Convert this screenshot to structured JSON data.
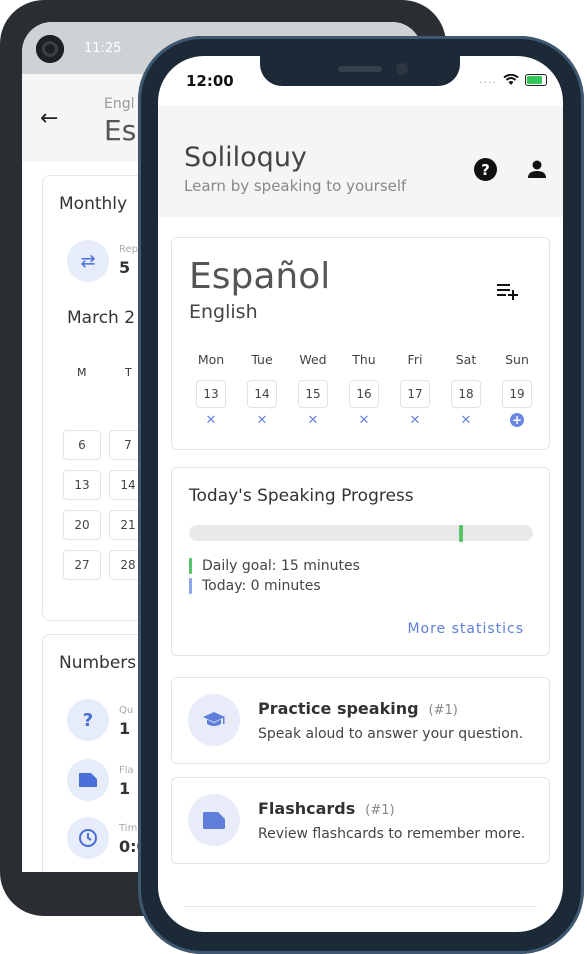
{
  "back_phone": {
    "status_time": "11:25",
    "header_subtitle": "Engl",
    "header_title": "Es",
    "card1_title": "Monthly",
    "repeat_label": "Rep",
    "repeat_value": "5",
    "month_label": "March 2",
    "dow": [
      "M",
      "T"
    ],
    "days": [
      "6",
      "7",
      "13",
      "14",
      "20",
      "21",
      "27",
      "28"
    ],
    "card2_title": "Numbers",
    "stats": [
      {
        "icon": "question-icon",
        "label": "Qu",
        "value": "1"
      },
      {
        "icon": "flashcard-icon",
        "label": "Fla",
        "value": "1"
      },
      {
        "icon": "clock-icon",
        "label": "Tim",
        "value": "0:0"
      }
    ]
  },
  "status_bar": {
    "time": "12:00",
    "signal": "....",
    "wifi": "wifi-icon",
    "battery": "battery-charging-icon"
  },
  "header": {
    "title": "Soliloquy",
    "subtitle": "Learn by speaking to yourself",
    "help_icon": "help-icon",
    "profile_icon": "person-icon"
  },
  "language_card": {
    "language": "Español",
    "native": "English",
    "add_icon": "playlist-add-icon",
    "week": [
      {
        "day": "Mon",
        "date": "13",
        "status": "missed"
      },
      {
        "day": "Tue",
        "date": "14",
        "status": "missed"
      },
      {
        "day": "Wed",
        "date": "15",
        "status": "missed"
      },
      {
        "day": "Thu",
        "date": "16",
        "status": "missed"
      },
      {
        "day": "Fri",
        "date": "17",
        "status": "missed"
      },
      {
        "day": "Sat",
        "date": "18",
        "status": "missed"
      },
      {
        "day": "Sun",
        "date": "19",
        "status": "today"
      }
    ],
    "missed_mark": "✕",
    "today_mark": "+"
  },
  "progress_card": {
    "title": "Today's Speaking Progress",
    "goal_fraction": 0.79,
    "today_fraction": 0,
    "goal_text": "Daily goal: 15 minutes",
    "today_text": "Today: 0 minutes",
    "goal_color": "#57c46a",
    "today_color": "#8fa6ea",
    "more_stats": "More statistics"
  },
  "activities": [
    {
      "title": "Practice speaking",
      "count": "(#1)",
      "desc": "Speak aloud to answer your question.",
      "icon": "graduation-cap-icon"
    },
    {
      "title": "Flashcards",
      "count": "(#1)",
      "desc": "Review flashcards to remember more.",
      "icon": "flashcard-icon"
    }
  ],
  "colors": {
    "accent": "#5e7fd9",
    "accent_light": "#e8ecf9",
    "header_bg": "#f5f5f5"
  }
}
